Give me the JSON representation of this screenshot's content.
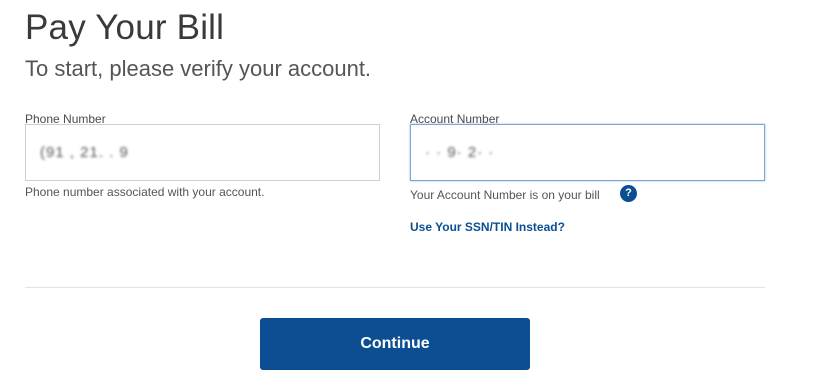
{
  "header": {
    "title": "Pay Your Bill",
    "subtitle": "To start, please verify your account."
  },
  "form": {
    "phone": {
      "label": "Phone Number",
      "value": "(91 , 21. . 9",
      "helper": "Phone number associated with your account."
    },
    "account": {
      "label": "Account Number",
      "value": "· · 9· 2· ·",
      "helper": "Your Account Number is on your bill",
      "help_icon": "?",
      "help_icon_name": "question-mark-icon"
    },
    "alt_link": "Use Your SSN/TIN Instead?"
  },
  "actions": {
    "continue_label": "Continue"
  },
  "colors": {
    "primary": "#0b4f92",
    "focus_border": "#7aa7cf"
  }
}
